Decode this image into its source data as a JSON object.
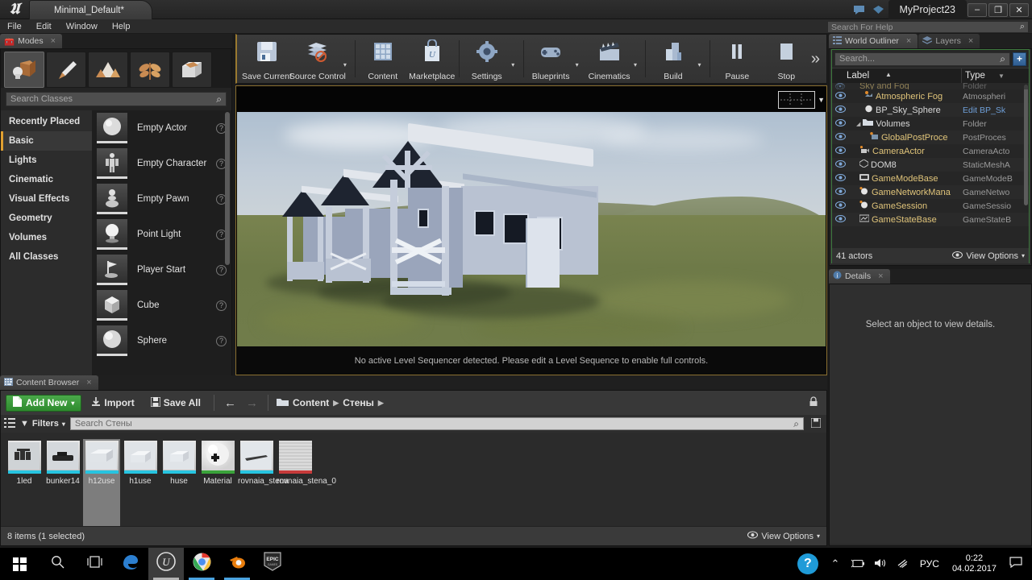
{
  "titlebar": {
    "logo": "unreal-logo",
    "level_tab": "Minimal_Default*",
    "project_name": "MyProject23",
    "icon_feedback": "feedback-icon",
    "icon_marketplace": "marketplace-icon",
    "minimize": "–",
    "maximize": "❐",
    "close": "✕"
  },
  "menubar": {
    "items": [
      "File",
      "Edit",
      "Window",
      "Help"
    ],
    "help_search_placeholder": "Search For Help"
  },
  "modes": {
    "tab_label": "Modes",
    "tabs": [
      {
        "name": "place-mode",
        "glyph": "📦"
      },
      {
        "name": "paint-mode",
        "glyph": "🖌"
      },
      {
        "name": "landscape-mode",
        "glyph": "⛰"
      },
      {
        "name": "foliage-mode",
        "glyph": "🌿"
      },
      {
        "name": "geometry-edit-mode",
        "glyph": "🏠"
      }
    ],
    "search_placeholder": "Search Classes",
    "categories": [
      "Recently Placed",
      "Basic",
      "Lights",
      "Cinematic",
      "Visual Effects",
      "Geometry",
      "Volumes",
      "All Classes"
    ],
    "selected_category": "Basic",
    "items": [
      {
        "label": "Empty Actor",
        "glyph": "⬤"
      },
      {
        "label": "Empty Character",
        "glyph": "🧍"
      },
      {
        "label": "Empty Pawn",
        "glyph": "♟"
      },
      {
        "label": "Point Light",
        "glyph": "💡"
      },
      {
        "label": "Player Start",
        "glyph": "🚩"
      },
      {
        "label": "Cube",
        "glyph": "⬛"
      },
      {
        "label": "Sphere",
        "glyph": "⬤"
      }
    ]
  },
  "toolbar": {
    "buttons": [
      {
        "label": "Save Current",
        "icon": "save-icon",
        "glyph": "💾",
        "dropdown": false
      },
      {
        "label": "Source Control",
        "icon": "source-control-icon",
        "glyph": "🗂",
        "dropdown": true
      },
      {
        "label": "Content",
        "icon": "content-icon",
        "glyph": "🗄",
        "dropdown": false
      },
      {
        "label": "Marketplace",
        "icon": "marketplace-icon",
        "glyph": "🛍",
        "dropdown": false
      },
      {
        "label": "Settings",
        "icon": "settings-icon",
        "glyph": "⚙",
        "dropdown": true
      },
      {
        "label": "Blueprints",
        "icon": "blueprints-icon",
        "glyph": "🎮",
        "dropdown": true
      },
      {
        "label": "Cinematics",
        "icon": "cinematics-icon",
        "glyph": "🎬",
        "dropdown": true
      },
      {
        "label": "Build",
        "icon": "build-icon",
        "glyph": "🏗",
        "dropdown": true
      },
      {
        "label": "Pause",
        "icon": "pause-icon",
        "glyph": "⏸",
        "dropdown": false
      },
      {
        "label": "Stop",
        "icon": "stop-icon",
        "glyph": "⏹",
        "dropdown": false
      }
    ],
    "overflow": "»"
  },
  "viewport": {
    "notice": "No active Level Sequencer detected. Please edit a Level Sequence to enable full controls.",
    "sequencer_widget": "sequencer-timeline-widget",
    "scene_description": "three-cabin-houses-on-grass-hill"
  },
  "content_browser": {
    "tab_label": "Content Browser",
    "add_new": "Add New",
    "import": "Import",
    "save_all": "Save All",
    "breadcrumb": [
      "Content",
      "Стены"
    ],
    "filters_label": "Filters",
    "search_placeholder": "Search Стены",
    "assets": [
      {
        "name": "1led",
        "thumb": "mesh",
        "glyph": "▨"
      },
      {
        "name": "bunker14",
        "thumb": "mesh",
        "glyph": "▬"
      },
      {
        "name": "h12use",
        "thumb": "mesh",
        "glyph": "◳",
        "selected": true
      },
      {
        "name": "h1use",
        "thumb": "mesh",
        "glyph": "◳"
      },
      {
        "name": "huse",
        "thumb": "mesh",
        "glyph": "◳"
      },
      {
        "name": "Material",
        "thumb": "material",
        "glyph": "✛"
      },
      {
        "name": "rovnaia_stena",
        "thumb": "mesh",
        "glyph": "▭"
      },
      {
        "name": "rovnaia_stena_0",
        "thumb": "red",
        "glyph": ""
      }
    ],
    "status": "8 items (1 selected)",
    "view_options": "View Options"
  },
  "outliner": {
    "tabs": [
      {
        "label": "World Outliner",
        "active": true
      },
      {
        "label": "Layers",
        "active": false
      }
    ],
    "search_placeholder": "Search...",
    "columns": {
      "label": "Label",
      "type": "Type"
    },
    "rows": [
      {
        "label": "Sky and Fog",
        "type": "Folder",
        "icon": "folder-icon",
        "indent": 1,
        "clipped": true
      },
      {
        "label": "Atmospheric Fog",
        "type": "Atmospheri",
        "icon": "fog-icon",
        "indent": 2
      },
      {
        "label": "BP_Sky_Sphere",
        "type": "Edit BP_Sk",
        "icon": "sphere-icon",
        "indent": 2,
        "type_link": true
      },
      {
        "label": "Volumes",
        "type": "Folder",
        "icon": "folder-icon",
        "indent": 1
      },
      {
        "label": "GlobalPostProce",
        "type": "PostProces",
        "icon": "volume-icon",
        "indent": 2
      },
      {
        "label": "CameraActor",
        "type": "CameraActo",
        "icon": "camera-icon",
        "indent": 1
      },
      {
        "label": "DOM8",
        "type": "StaticMeshA",
        "icon": "mesh-icon",
        "indent": 1
      },
      {
        "label": "GameModeBase",
        "type": "GameModeB",
        "icon": "gamemode-icon",
        "indent": 1
      },
      {
        "label": "GameNetworkMana",
        "type": "GameNetwo",
        "icon": "sphere-icon",
        "indent": 1
      },
      {
        "label": "GameSession",
        "type": "GameSessio",
        "icon": "sphere-icon",
        "indent": 1
      },
      {
        "label": "GameStateBase",
        "type": "GameStateB",
        "icon": "gamestate-icon",
        "indent": 1
      }
    ],
    "footer_count": "41 actors",
    "view_options": "View Options"
  },
  "details": {
    "tab_label": "Details",
    "empty_message": "Select an object to view details."
  },
  "taskbar": {
    "start": "start-button",
    "search": "search-icon",
    "taskview": "task-view-icon",
    "apps": [
      {
        "name": "edge",
        "glyph": "e",
        "color": "#2c7fd0",
        "active": false,
        "running": false
      },
      {
        "name": "unreal-engine",
        "glyph": "𝖀",
        "color": "#e8e8e8",
        "active": true,
        "running": true
      },
      {
        "name": "chrome",
        "glyph": "◉",
        "color": "#4caf50",
        "active": false,
        "running": true
      },
      {
        "name": "blender",
        "glyph": "◑",
        "color": "#e87d0d",
        "active": false,
        "running": true
      },
      {
        "name": "epic-games",
        "glyph": "EPIC",
        "color": "#d8d8d8",
        "active": false,
        "running": false
      }
    ],
    "tray": {
      "help": "?",
      "chevron": "⌃",
      "battery": "battery-icon",
      "volume": "🔊",
      "wifi": "wifi-icon",
      "language": "РУС",
      "time": "0:22",
      "date": "04.02.2017",
      "notifications": "notification-icon"
    }
  }
}
